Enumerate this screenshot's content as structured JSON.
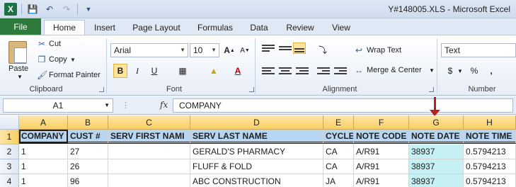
{
  "window": {
    "title": "Y#148005.XLS  -  Microsoft Excel"
  },
  "quick_access": {
    "logo": "X"
  },
  "tabs": [
    {
      "label": "File"
    },
    {
      "label": "Home"
    },
    {
      "label": "Insert"
    },
    {
      "label": "Page Layout"
    },
    {
      "label": "Formulas"
    },
    {
      "label": "Data"
    },
    {
      "label": "Review"
    },
    {
      "label": "View"
    }
  ],
  "ribbon": {
    "clipboard": {
      "label": "Clipboard",
      "paste": "Paste",
      "cut": "Cut",
      "copy": "Copy",
      "format_painter": "Format Painter"
    },
    "font": {
      "label": "Font",
      "family": "Arial",
      "size": "10",
      "bold": "B",
      "italic": "I",
      "underline": "U"
    },
    "alignment": {
      "label": "Alignment",
      "wrap_text": "Wrap Text",
      "merge_center": "Merge & Center"
    },
    "number": {
      "label": "Number",
      "format": "Text",
      "currency": "$",
      "percent": "%",
      "comma": ","
    }
  },
  "formula_bar": {
    "name_box": "A1",
    "fx": "fx",
    "value": "COMPANY"
  },
  "columns": [
    "A",
    "B",
    "C",
    "D",
    "E",
    "F",
    "G",
    "H"
  ],
  "rows": [
    "1",
    "2",
    "3",
    "4"
  ],
  "sheet": {
    "header": [
      "COMPANY",
      "CUST #",
      "SERV FIRST NAMI",
      "SERV LAST NAME",
      "CYCLE",
      "NOTE CODE",
      "NOTE DATE",
      "NOTE TIME"
    ],
    "data": [
      [
        "1",
        "27",
        "",
        "GERALD'S PHARMACY",
        "CA",
        "A/R91",
        "38937",
        "0.5794213"
      ],
      [
        "1",
        "26",
        "",
        "FLUFF & FOLD",
        "CA",
        "A/R91",
        "38937",
        "0.5794213"
      ],
      [
        "1",
        "96",
        "",
        "ABC CONSTRUCTION",
        "JA",
        "A/R91",
        "38937",
        "0.5794213"
      ]
    ]
  },
  "colors": {
    "file_tab": "#2d7a3c",
    "header_fill": "#b8d6f2",
    "highlight_col": "#c5f1f4",
    "arrow": "#b3221d"
  }
}
